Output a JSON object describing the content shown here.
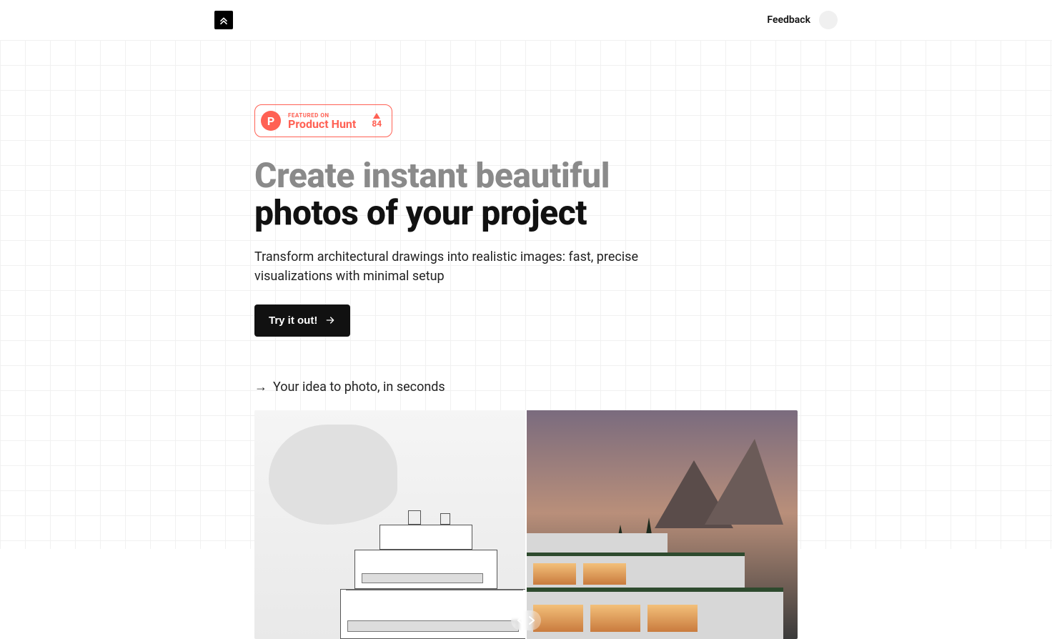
{
  "header": {
    "feedback_label": "Feedback"
  },
  "product_hunt": {
    "featured_label": "FEATURED ON",
    "name": "Product Hunt",
    "upvotes": "84",
    "letter": "P"
  },
  "hero": {
    "headline_line1": "Create instant beautiful",
    "headline_line2": "photos of your project",
    "subheading": "Transform architectural drawings into realistic images: fast, precise visualizations with minimal setup",
    "cta_label": "Try it out!"
  },
  "tagline": {
    "arrow": "→",
    "text": "Your idea to photo, in seconds"
  }
}
